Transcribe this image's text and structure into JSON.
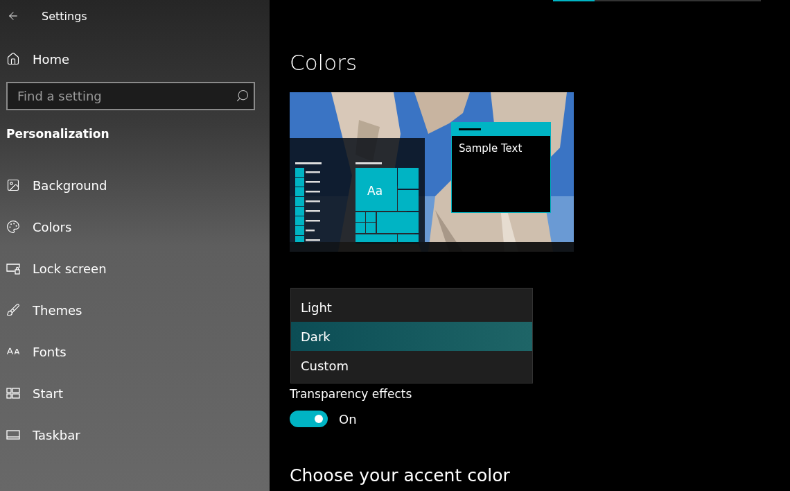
{
  "window": {
    "title": "Settings"
  },
  "progress": {
    "level": 0.2
  },
  "sidebar": {
    "home": "Home",
    "search": {
      "placeholder": "Find a setting"
    },
    "section": "Personalization",
    "items": [
      {
        "label": "Background",
        "kind": "background"
      },
      {
        "label": "Colors",
        "kind": "colors"
      },
      {
        "label": "Lock screen",
        "kind": "lock"
      },
      {
        "label": "Themes",
        "kind": "themes"
      },
      {
        "label": "Fonts",
        "kind": "fonts"
      },
      {
        "label": "Start",
        "kind": "start"
      },
      {
        "label": "Taskbar",
        "kind": "taskbar"
      }
    ]
  },
  "page": {
    "title": "Colors",
    "preview": {
      "tile_text": "Aa",
      "window_text": "Sample Text"
    },
    "color_menu": {
      "options": [
        {
          "label": "Light",
          "selected": false
        },
        {
          "label": "Dark",
          "selected": true
        },
        {
          "label": "Custom",
          "selected": false
        }
      ]
    },
    "transparency": {
      "label": "Transparency effects",
      "on": true,
      "state_text": "On"
    },
    "accent_heading": "Choose your accent color"
  }
}
